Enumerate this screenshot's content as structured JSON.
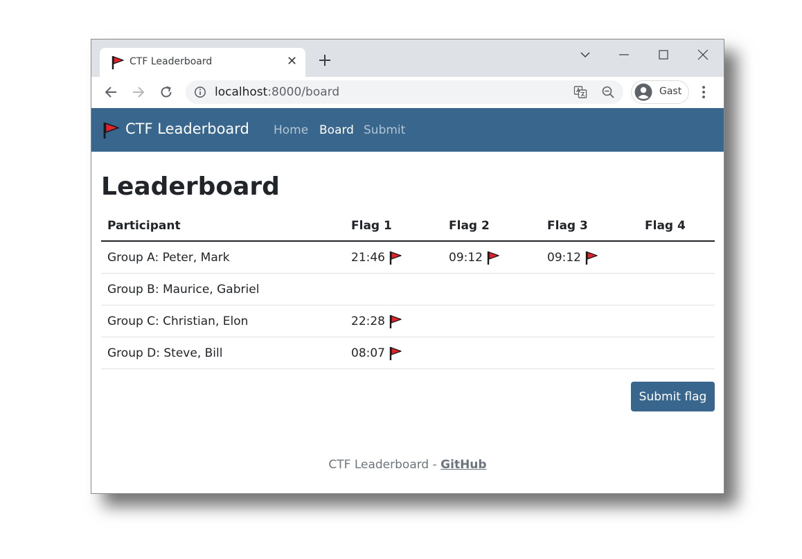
{
  "browser": {
    "tab_title": "CTF Leaderboard",
    "tab_close": "✕",
    "url_host": "localhost",
    "url_path": ":8000/board",
    "profile_name": "Gast"
  },
  "navbar": {
    "brand": "CTF Leaderboard",
    "links": [
      {
        "label": "Home",
        "active": false
      },
      {
        "label": "Board",
        "active": true
      },
      {
        "label": "Submit",
        "active": false
      }
    ]
  },
  "page": {
    "title": "Leaderboard"
  },
  "table": {
    "headers": [
      "Participant",
      "Flag 1",
      "Flag 2",
      "Flag 3",
      "Flag 4"
    ],
    "rows": [
      {
        "participant": "Group A: Peter, Mark",
        "flags": [
          "21:46",
          "09:12",
          "09:12",
          ""
        ]
      },
      {
        "participant": "Group B: Maurice, Gabriel",
        "flags": [
          "",
          "",
          "",
          ""
        ]
      },
      {
        "participant": "Group C: Christian, Elon",
        "flags": [
          "22:28",
          "",
          "",
          ""
        ]
      },
      {
        "participant": "Group D: Steve, Bill",
        "flags": [
          "08:07",
          "",
          "",
          ""
        ]
      }
    ]
  },
  "submit_button": "Submit flag",
  "footer": {
    "text": "CTF Leaderboard - ",
    "link": "GitHub"
  },
  "colors": {
    "navbar": "#38668c",
    "flag_red": "#e8202a",
    "tabstrip": "#dee1e6"
  }
}
